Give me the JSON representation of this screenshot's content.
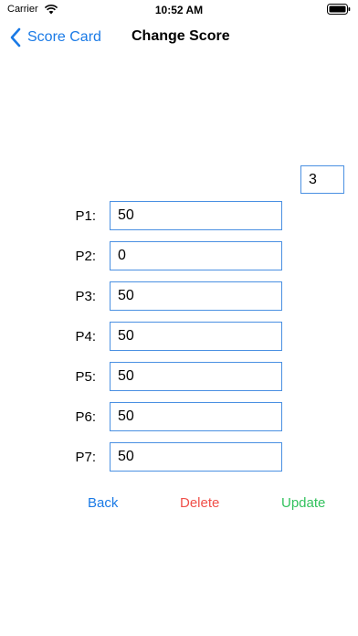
{
  "status": {
    "carrier": "Carrier",
    "time": "10:52 AM"
  },
  "nav": {
    "back_label": "Score Card",
    "title": "Change Score"
  },
  "round": {
    "value": "3"
  },
  "players": [
    {
      "label": "P1:",
      "value": "50"
    },
    {
      "label": "P2:",
      "value": "0"
    },
    {
      "label": "P3:",
      "value": "50"
    },
    {
      "label": "P4:",
      "value": "50"
    },
    {
      "label": "P5:",
      "value": "50"
    },
    {
      "label": "P6:",
      "value": "50"
    },
    {
      "label": "P7:",
      "value": "50"
    }
  ],
  "actions": {
    "back": "Back",
    "delete": "Delete",
    "update": "Update"
  },
  "colors": {
    "accent": "#1a7ae6",
    "delete": "#f0504a",
    "update": "#33c25e",
    "field_border": "#4a90e2"
  }
}
